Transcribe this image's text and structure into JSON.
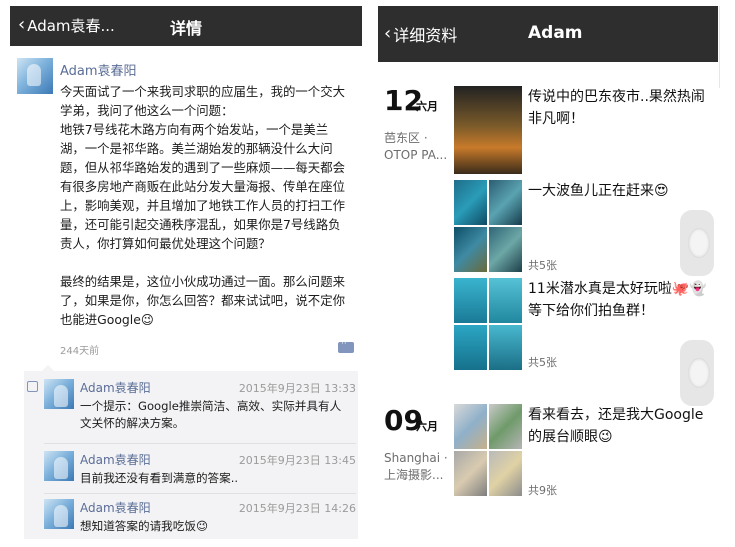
{
  "left": {
    "back_label": "Adam袁春...",
    "title": "详情",
    "post": {
      "author": "Adam袁春阳",
      "body": "今天面试了一个来我司求职的应届生，我的一个交大学弟，我问了他这么一个问题：\n地铁7号线花木路方向有两个始发站，一个是美兰湖，一个是祁华路。美兰湖始发的那辆没什么大问题，但从祁华路始发的遇到了一些麻烦——每天都会有很多房地产商贩在此站分发大量海报、传单在座位上，影响美观，并且增加了地铁工作人员的打扫工作量，还可能引起交通秩序混乱，如果你是7号线路负责人，你打算如何最优处理这个问题？\n\n最终的结果是，这位小伙成功通过一面。那么问题来了，如果是你，你怎么回答？都来试试吧，说不定你也能进Google😉",
      "time": "244天前"
    },
    "comments": [
      {
        "author": "Adam袁春阳",
        "date": "2015年9月23日 13:33",
        "text": "一个提示：Google推崇简洁、高效、实际并具有人文关怀的解决方案。"
      },
      {
        "author": "Adam袁春阳",
        "date": "2015年9月23日 13:45",
        "text": "目前我还没有看到满意的答案.."
      },
      {
        "author": "Adam袁春阳",
        "date": "2015年9月23日 14:26",
        "text": "想知道答案的请我吃饭😉"
      }
    ]
  },
  "right": {
    "back_label": "详细资料",
    "title": "Adam",
    "groups": [
      {
        "day": "12",
        "month": "六月",
        "location": "芭东区 · OTOP PA...",
        "entries": [
          {
            "text": "传说中的巴东夜市..果然热闹非凡啊！",
            "count": ""
          },
          {
            "text": "一大波鱼儿正在赶来😍",
            "count": "共5张"
          },
          {
            "text": "11米潜水真是太好玩啦🐙👻等下给你们拍鱼群！",
            "count": "共5张"
          }
        ]
      },
      {
        "day": "09",
        "month": "六月",
        "location": "Shanghai · 上海摄影...",
        "entries": [
          {
            "text": "看来看去，还是我大Google的展台顺眼😉",
            "count": "共9张"
          }
        ]
      }
    ]
  }
}
